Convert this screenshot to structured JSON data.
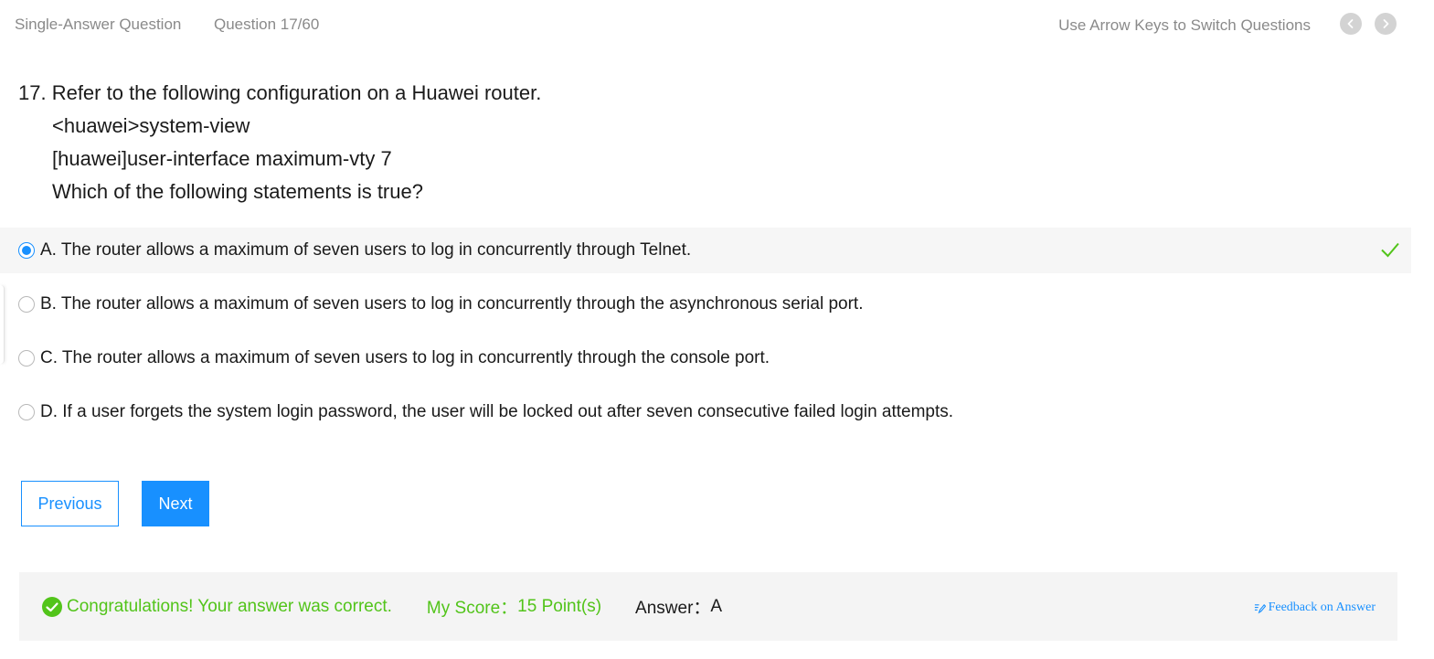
{
  "header": {
    "question_type": "Single-Answer Question",
    "question_count": "Question 17/60",
    "hint": "Use Arrow Keys to Switch Questions",
    "prev_icon": "chevron-left-icon",
    "next_icon": "chevron-right-icon"
  },
  "question": {
    "line1": "17. Refer to the following configuration on a Huawei router.",
    "line2": "<huawei>system-view",
    "line3": "[huawei]user-interface maximum-vty 7",
    "line4": "Which of the following statements is true?"
  },
  "options": [
    {
      "label": "A. The router allows a maximum of seven users to log in concurrently through Telnet.",
      "selected": true,
      "correct": true
    },
    {
      "label": "B. The router allows a maximum of seven users to log in concurrently through the asynchronous serial port.",
      "selected": false
    },
    {
      "label": "C. The router allows a maximum of seven users to log in concurrently through the console port.",
      "selected": false
    },
    {
      "label": "D. If a user forgets the system login password, the user will be locked out after seven consecutive failed login attempts.",
      "selected": false
    }
  ],
  "buttons": {
    "previous": "Previous",
    "next": "Next"
  },
  "result": {
    "message": "Congratulations! Your answer was correct.",
    "score_label": "My Score：",
    "score_value": "15 Point(s)",
    "answer_label": "Answer：",
    "answer_value": "A",
    "feedback": "Feedback on Answer"
  },
  "colors": {
    "accent": "#1890ff",
    "success": "#52c41a",
    "muted_text": "#8a8a8a"
  }
}
